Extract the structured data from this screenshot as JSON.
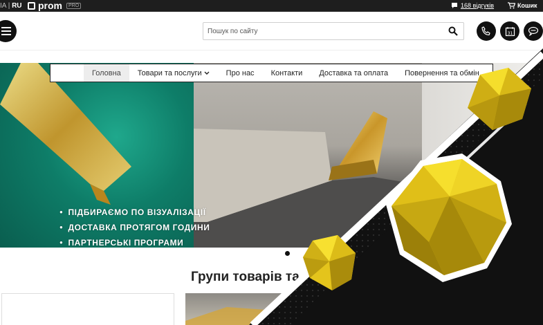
{
  "topbar": {
    "lang_prev": "IA",
    "lang_sep": "|",
    "lang_current": "RU",
    "brand": "prom",
    "brand_badge": "PRO",
    "reviews": "168 відгуків",
    "cart": "Кошик"
  },
  "header": {
    "search_placeholder": "Пошук по сайту",
    "icons": [
      "menu-icon",
      "search-icon",
      "phone-icon",
      "calendar-icon",
      "chat-icon"
    ],
    "calendar_day": "31"
  },
  "nav": {
    "items": [
      {
        "label": "Головна",
        "active": true
      },
      {
        "label": "Товари та послуги",
        "dropdown": true
      },
      {
        "label": "Про нас"
      },
      {
        "label": "Контакти"
      },
      {
        "label": "Доставка та оплата"
      },
      {
        "label": "Повернення та обмін"
      }
    ]
  },
  "hero": {
    "bullets": [
      "ПІДБИРАЄМО ПО ВІЗУАЛІЗАЦІЇ",
      "ДОСТАВКА ПРОТЯГОМ ГОДИНИ",
      "ПАРТНЕРСЬКІ ПРОГРАМИ"
    ]
  },
  "section": {
    "title": "Групи товарів та"
  },
  "colors": {
    "topbar": "#1e1e1e",
    "accent_yellow": "#f2d60a",
    "dark": "#111111",
    "teal": "#0e7d68"
  }
}
